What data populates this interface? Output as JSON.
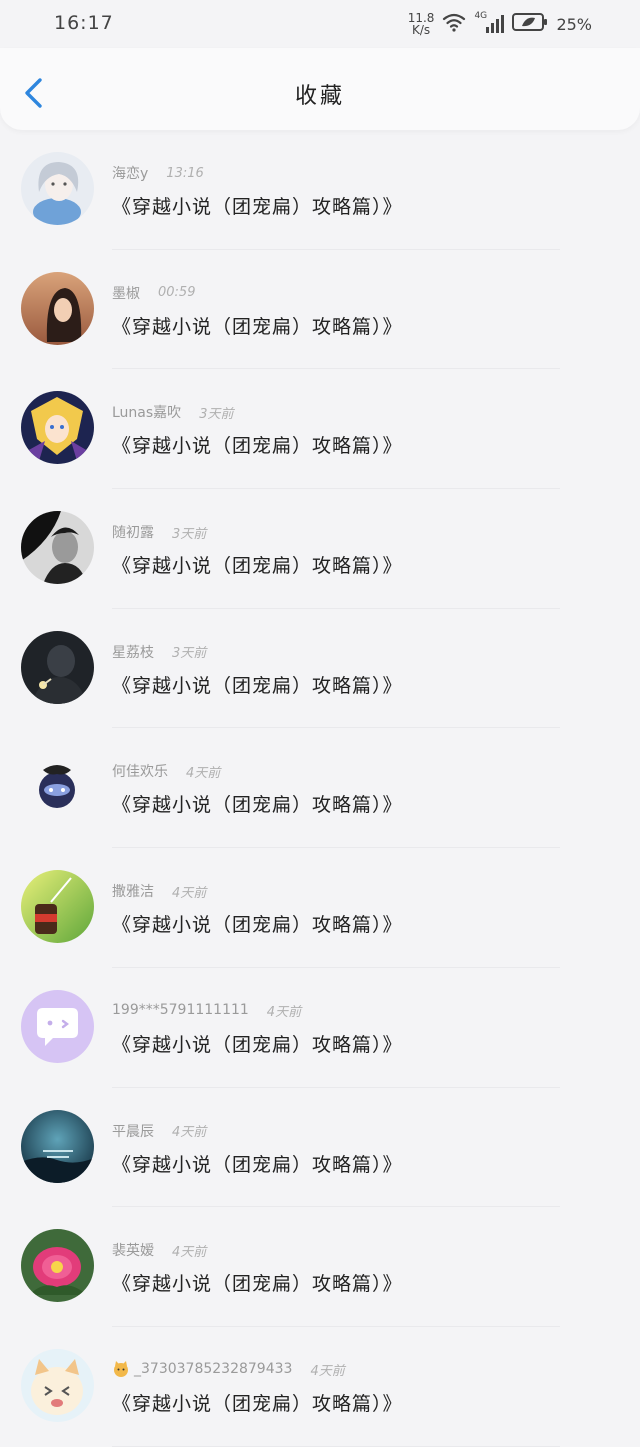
{
  "status_bar": {
    "time": "16:17",
    "net_speed_value": "11.8",
    "net_speed_unit": "K/s",
    "network_type": "4G",
    "battery": "25%"
  },
  "header": {
    "title": "收藏",
    "back_icon": "chevron-left-icon"
  },
  "colors": {
    "accent": "#2e86de",
    "title": "#222222",
    "meta": "#9a9a9a"
  },
  "items": [
    {
      "name": "海恋y",
      "time": "13:16",
      "title": "《穿越小说（团宠扁）攻略篇）》"
    },
    {
      "name": "墨椒",
      "time": "00:59",
      "title": "《穿越小说（团宠扁）攻略篇）》"
    },
    {
      "name": "Lunas嘉吹",
      "time": "3天前",
      "title": "《穿越小说（团宠扁）攻略篇）》"
    },
    {
      "name": "随初露",
      "time": "3天前",
      "title": "《穿越小说（团宠扁）攻略篇）》"
    },
    {
      "name": "星荔枝",
      "time": "3天前",
      "title": "《穿越小说（团宠扁）攻略篇）》"
    },
    {
      "name": "何佳欢乐",
      "time": "4天前",
      "title": "《穿越小说（团宠扁）攻略篇）》"
    },
    {
      "name": "撒雅洁",
      "time": "4天前",
      "title": "《穿越小说（团宠扁）攻略篇）》"
    },
    {
      "name": "199***5791111111",
      "time": "4天前",
      "title": "《穿越小说（团宠扁）攻略篇）》"
    },
    {
      "name": "平晨辰",
      "time": "4天前",
      "title": "《穿越小说（团宠扁）攻略篇）》"
    },
    {
      "name": "裴英嫒",
      "time": "4天前",
      "title": "《穿越小说（团宠扁）攻略篇）》"
    },
    {
      "name": "_37303785232879433",
      "time": "4天前",
      "title": "《穿越小说（团宠扁）攻略篇）》"
    }
  ]
}
